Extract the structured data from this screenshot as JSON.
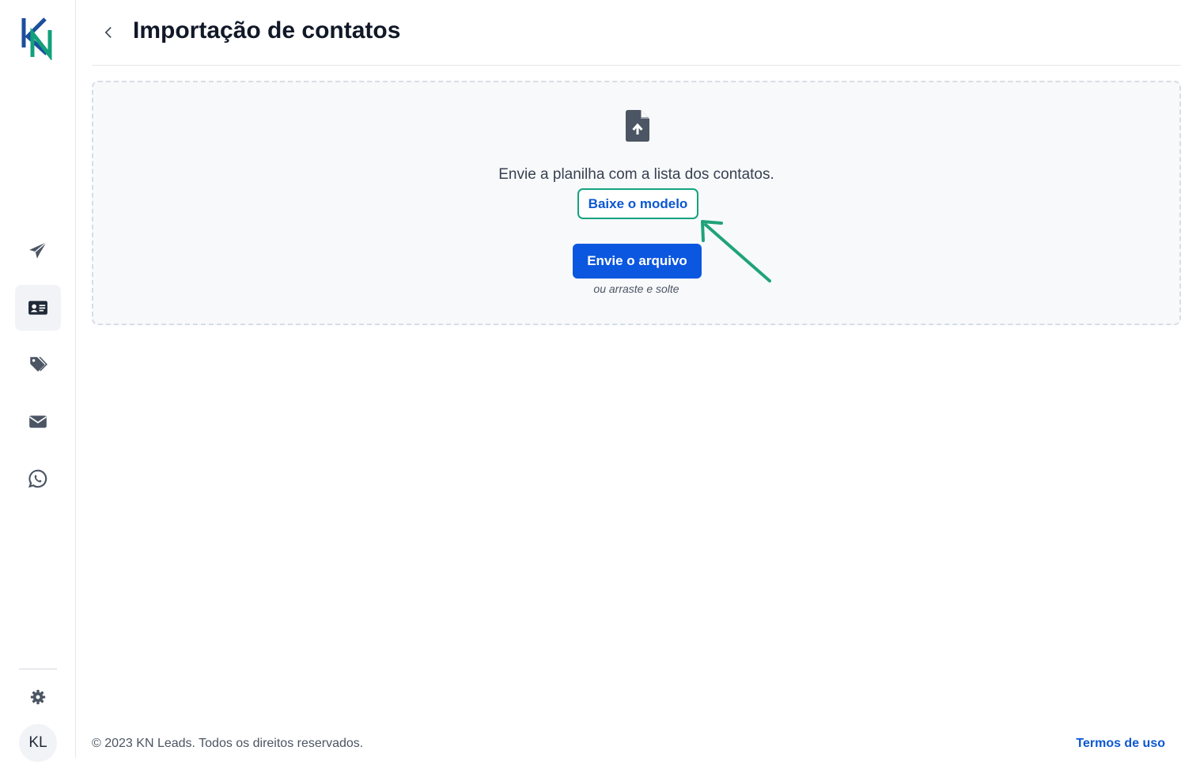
{
  "brand": {
    "logo_icon": "kn-logo-icon"
  },
  "header": {
    "title": "Importação de contatos",
    "back_icon": "chevron-left-icon"
  },
  "sidebar": {
    "items": [
      {
        "name": "campaigns",
        "icon": "paper-plane-icon",
        "active": false
      },
      {
        "name": "contacts",
        "icon": "contact-card-icon",
        "active": true
      },
      {
        "name": "tags",
        "icon": "tags-icon",
        "active": false
      },
      {
        "name": "email",
        "icon": "envelope-icon",
        "active": false
      },
      {
        "name": "whatsapp",
        "icon": "whatsapp-icon",
        "active": false
      }
    ],
    "settings_icon": "gear-icon",
    "avatar_initials": "KL"
  },
  "upload": {
    "icon": "file-upload-icon",
    "instruction": "Envie a planilha com a lista dos contatos.",
    "model_button": "Baixe o modelo",
    "send_button": "Envie o arquivo",
    "drag_hint": "ou arraste e solte"
  },
  "annotation": {
    "icon": "arrow-pointer-icon",
    "color": "#1fa37a"
  },
  "footer": {
    "copyright": "© 2023 KN Leads. Todos os direitos reservados.",
    "terms_link": "Termos de uso"
  },
  "colors": {
    "primary": "#0b57e0",
    "accent_green": "#14a37f",
    "icon_gray": "#4b5563",
    "logo_blue": "#1c4f9c",
    "logo_green": "#13a07c"
  }
}
